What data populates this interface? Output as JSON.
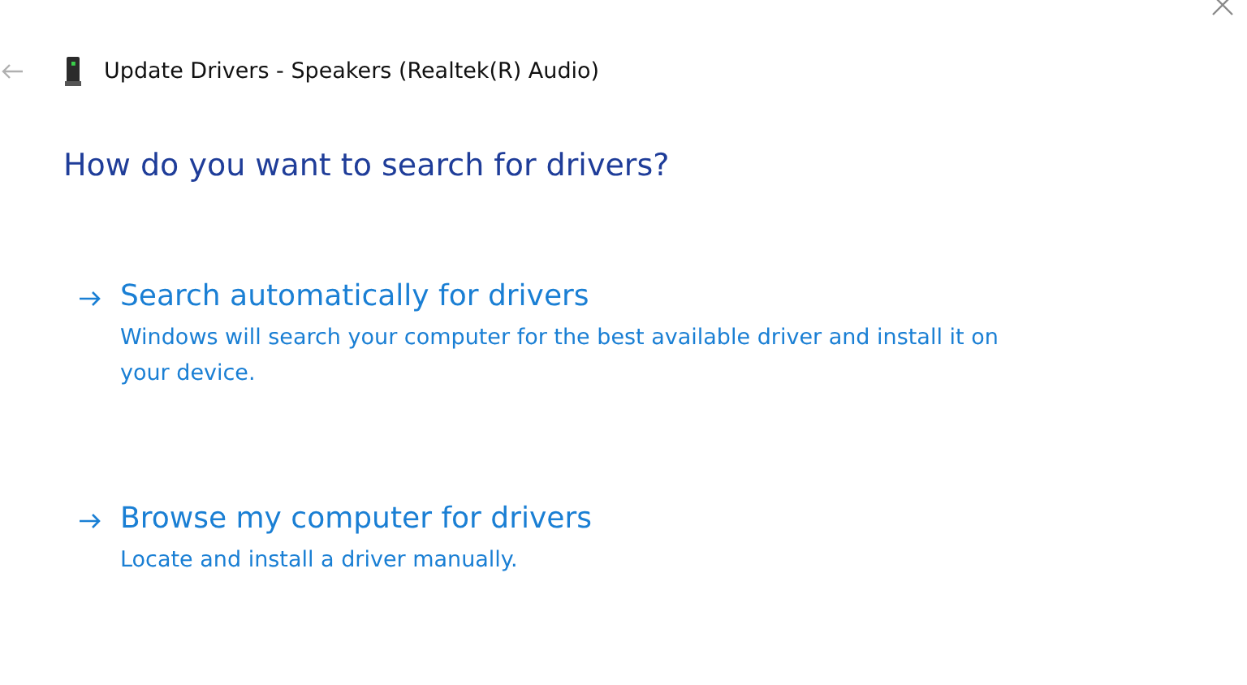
{
  "window": {
    "title": "Update Drivers - Speakers (Realtek(R) Audio)"
  },
  "heading": "How do you want to search for drivers?",
  "options": [
    {
      "title": "Search automatically for drivers",
      "description": "Windows will search your computer for the best available driver and install it on your device."
    },
    {
      "title": "Browse my computer for drivers",
      "description": "Locate and install a driver manually."
    }
  ]
}
